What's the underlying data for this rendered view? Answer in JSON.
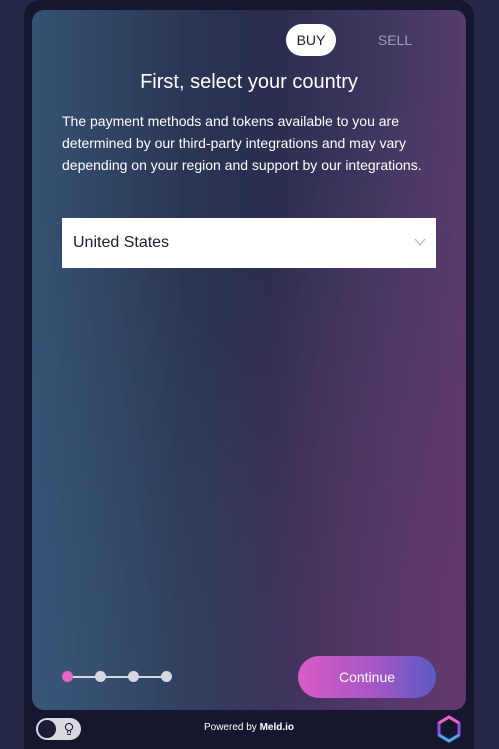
{
  "tabs": {
    "buy_label": "BUY",
    "sell_label": "SELL",
    "active": "BUY"
  },
  "main": {
    "title": "First, select your country",
    "description": "The payment methods and tokens available to you are determined by our third-party integrations and may vary depending on your region and support by our integrations."
  },
  "country_select": {
    "value": "United States",
    "icon": "chevron-down-icon"
  },
  "stepper": {
    "total_steps": 4,
    "current_step": 1
  },
  "continue_button": {
    "label": "Continue"
  },
  "footer": {
    "powered_prefix": "Powered by",
    "powered_brand": "Meld.io",
    "theme_toggle_icon": "lightbulb-icon",
    "logo_icon": "meld-logo-icon"
  },
  "colors": {
    "accent_pink": "#e864c6",
    "accent_blue": "#5a5bc2",
    "background": "#262847"
  }
}
